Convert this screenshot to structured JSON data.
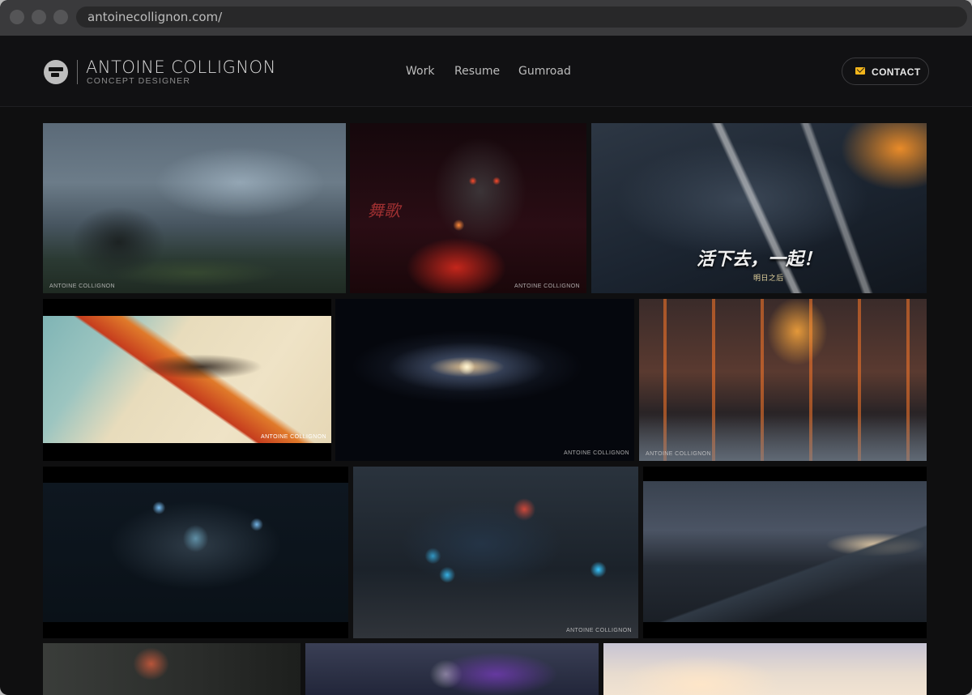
{
  "browser": {
    "url": "antoinecollignon.com/"
  },
  "header": {
    "brand_name": "ANTOINE COLLIGNON",
    "brand_subtitle": "CONCEPT DESIGNER",
    "nav": [
      {
        "label": "Work"
      },
      {
        "label": "Resume"
      },
      {
        "label": "Gumroad"
      }
    ],
    "contact_label": "CONTACT",
    "accent_color": "#f2b51c"
  },
  "gallery": {
    "tiles": [
      {
        "id": "foggy-ruins",
        "caption": "ANTOINE COLLIGNON"
      },
      {
        "id": "red-portrait",
        "caption": "ANTOINE COLLIGNON",
        "side_text": "舞歌"
      },
      {
        "id": "survivors-poster",
        "caption": "",
        "banner_text": "活下去，一起！",
        "banner_sub": "明日之后"
      },
      {
        "id": "desert-ship",
        "caption": "ANTOINE COLLIGNON"
      },
      {
        "id": "galaxy",
        "caption": "ANTOINE COLLIGNON"
      },
      {
        "id": "server-fight",
        "caption": "ANTOINE COLLIGNON"
      },
      {
        "id": "tunnel-figure",
        "caption": ""
      },
      {
        "id": "blue-mech",
        "caption": "ANTOINE COLLIGNON"
      },
      {
        "id": "stormy-city",
        "caption": ""
      },
      {
        "id": "graffiti-boy",
        "caption": ""
      },
      {
        "id": "purple-figure",
        "caption": ""
      },
      {
        "id": "sunset-sky",
        "caption": ""
      }
    ]
  }
}
